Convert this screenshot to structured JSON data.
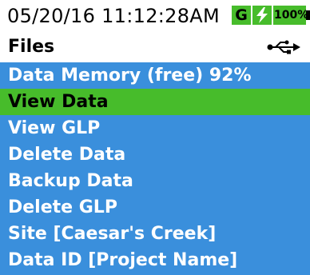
{
  "status_bar": {
    "datetime": "05/20/16  11:12:28AM",
    "gps_label": "G",
    "battery_level": "100%",
    "charging_icon": "lightning-bolt-icon"
  },
  "header": {
    "title": "Files",
    "usb_icon": "usb-icon"
  },
  "menu": {
    "items": [
      {
        "label": "Data Memory (free) 92%"
      },
      {
        "label": "View Data"
      },
      {
        "label": "View GLP"
      },
      {
        "label": "Delete Data"
      },
      {
        "label": "Backup Data"
      },
      {
        "label": "Delete GLP"
      },
      {
        "label": "Site [Caesar's Creek]"
      },
      {
        "label": "Data ID [Project Name]"
      }
    ],
    "selected_index": 1
  },
  "colors": {
    "menu_background": "#3a8fdc",
    "highlight": "#47bc2b",
    "menu_text": "#ffffff",
    "selected_text": "#000000"
  }
}
